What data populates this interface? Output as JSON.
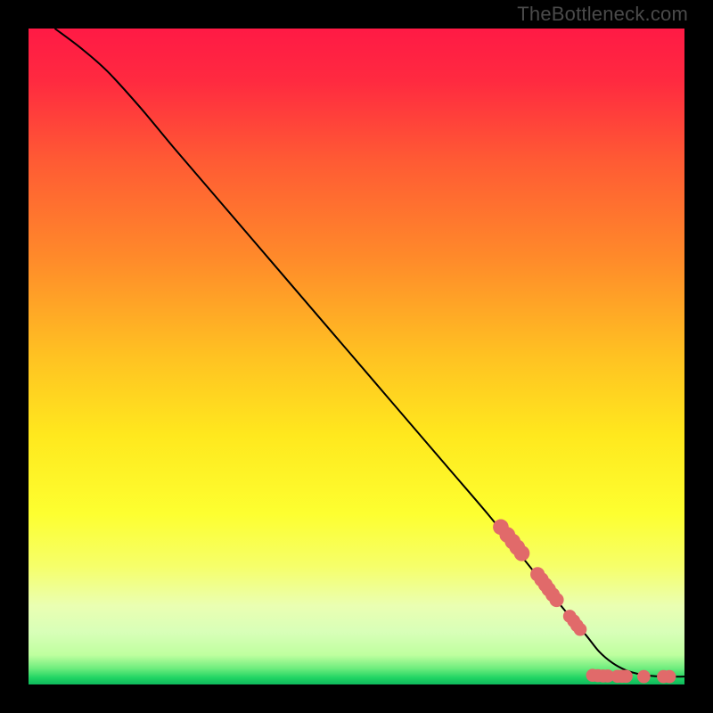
{
  "credit": "TheBottleneck.com",
  "colors": {
    "marker": "#e16a6a",
    "curve": "#000000",
    "border": "#000000",
    "gradient_stops": [
      {
        "offset": 0.0,
        "color": "#ff1a45"
      },
      {
        "offset": 0.08,
        "color": "#ff2a40"
      },
      {
        "offset": 0.2,
        "color": "#ff5a34"
      },
      {
        "offset": 0.35,
        "color": "#ff8a2a"
      },
      {
        "offset": 0.5,
        "color": "#ffc222"
      },
      {
        "offset": 0.62,
        "color": "#ffe81e"
      },
      {
        "offset": 0.74,
        "color": "#fdff30"
      },
      {
        "offset": 0.82,
        "color": "#f6ff6a"
      },
      {
        "offset": 0.88,
        "color": "#eaffb2"
      },
      {
        "offset": 0.92,
        "color": "#d8ffb8"
      },
      {
        "offset": 0.955,
        "color": "#bfff9f"
      },
      {
        "offset": 0.975,
        "color": "#70ed7e"
      },
      {
        "offset": 0.99,
        "color": "#1fd463"
      },
      {
        "offset": 1.0,
        "color": "#0fb85c"
      }
    ]
  },
  "chart_data": {
    "type": "line",
    "title": "",
    "xlabel": "",
    "ylabel": "",
    "xlim": [
      0,
      100
    ],
    "ylim": [
      0,
      100
    ],
    "series": [
      {
        "name": "curve",
        "x": [
          4,
          8,
          12,
          17,
          22,
          28,
          34,
          40,
          46,
          52,
          58,
          64,
          70,
          74,
          78,
          82,
          85,
          87,
          89,
          91,
          93,
          95,
          97,
          100
        ],
        "y": [
          100,
          97,
          93.5,
          88,
          82,
          75,
          68,
          61,
          54,
          47,
          40,
          33,
          26,
          21,
          16,
          11,
          7.5,
          5,
          3.3,
          2.2,
          1.6,
          1.3,
          1.2,
          1.2
        ]
      }
    ],
    "markers": [
      {
        "x": 72,
        "y": 24.0,
        "r": 1.2
      },
      {
        "x": 73,
        "y": 22.8,
        "r": 1.2
      },
      {
        "x": 73.8,
        "y": 21.8,
        "r": 1.2
      },
      {
        "x": 74.5,
        "y": 20.9,
        "r": 1.2
      },
      {
        "x": 75.2,
        "y": 20.0,
        "r": 1.2
      },
      {
        "x": 77.6,
        "y": 16.8,
        "r": 1.1
      },
      {
        "x": 78.2,
        "y": 16.0,
        "r": 1.1
      },
      {
        "x": 78.8,
        "y": 15.2,
        "r": 1.1
      },
      {
        "x": 79.3,
        "y": 14.5,
        "r": 1.1
      },
      {
        "x": 79.9,
        "y": 13.7,
        "r": 1.1
      },
      {
        "x": 80.5,
        "y": 12.9,
        "r": 1.1
      },
      {
        "x": 82.5,
        "y": 10.4,
        "r": 1.0
      },
      {
        "x": 83.1,
        "y": 9.7,
        "r": 1.0
      },
      {
        "x": 83.6,
        "y": 9.0,
        "r": 1.0
      },
      {
        "x": 84.1,
        "y": 8.4,
        "r": 1.0
      },
      {
        "x": 86.0,
        "y": 1.4,
        "r": 1.0
      },
      {
        "x": 86.8,
        "y": 1.35,
        "r": 1.0
      },
      {
        "x": 87.6,
        "y": 1.3,
        "r": 1.0
      },
      {
        "x": 88.3,
        "y": 1.3,
        "r": 1.0
      },
      {
        "x": 89.8,
        "y": 1.25,
        "r": 1.0
      },
      {
        "x": 90.5,
        "y": 1.25,
        "r": 1.0
      },
      {
        "x": 91.1,
        "y": 1.25,
        "r": 1.0
      },
      {
        "x": 93.8,
        "y": 1.2,
        "r": 1.0
      },
      {
        "x": 96.8,
        "y": 1.2,
        "r": 1.0
      },
      {
        "x": 97.7,
        "y": 1.2,
        "r": 1.0
      }
    ]
  }
}
